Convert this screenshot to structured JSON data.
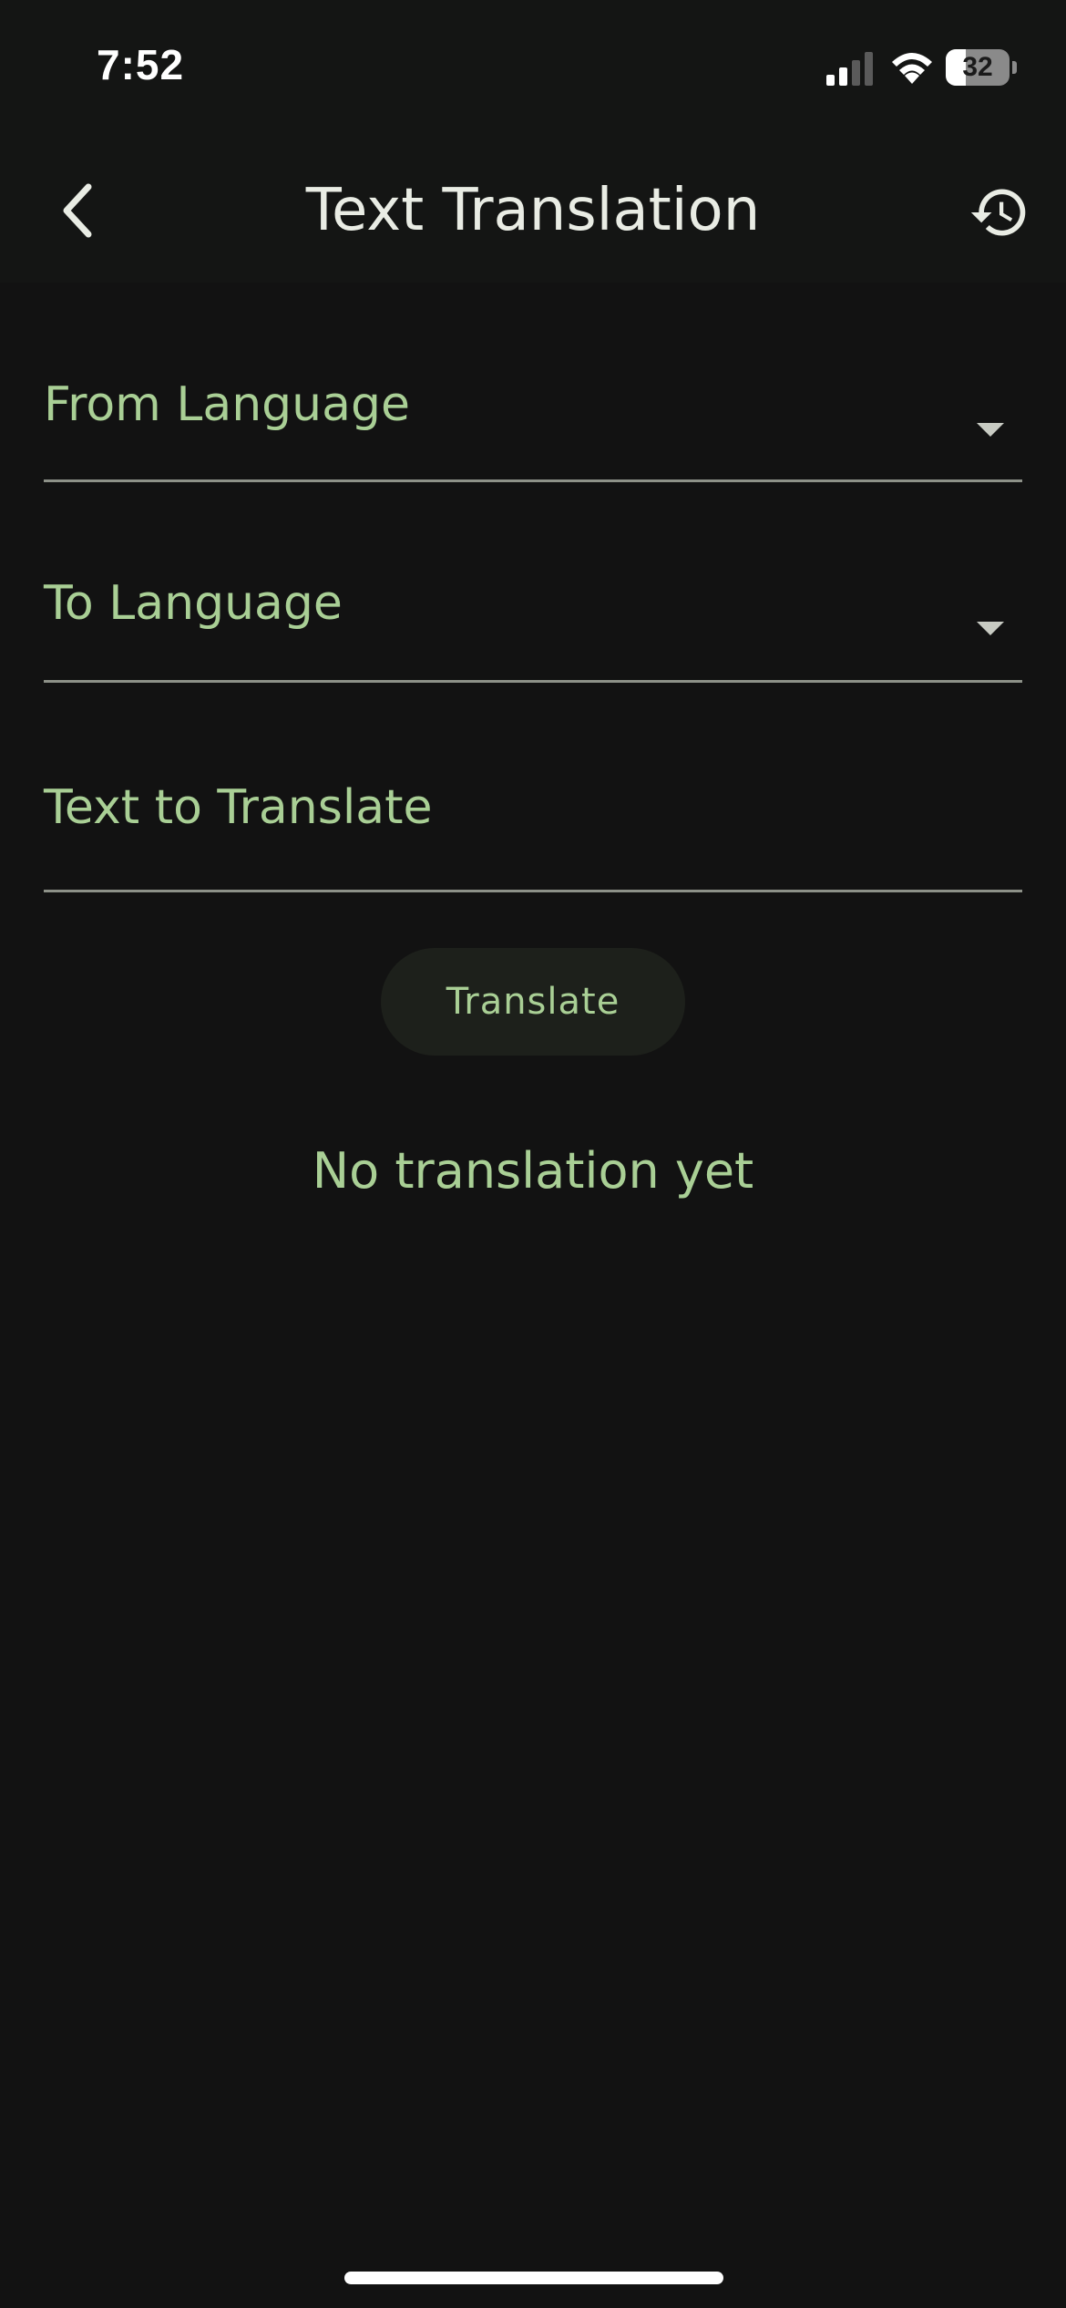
{
  "status_bar": {
    "time": "7:52",
    "battery_level": "32",
    "battery_fraction": 0.32,
    "signal_bars_active": 2,
    "signal_bars_total": 4
  },
  "header": {
    "title": "Text Translation",
    "back_icon": "chevron-left-icon",
    "history_icon": "history-icon"
  },
  "form": {
    "from_language_label": "From Language",
    "to_language_label": "To Language",
    "text_label": "Text to Translate",
    "translate_label": "Translate"
  },
  "result": {
    "empty_text": "No translation yet"
  },
  "colors": {
    "background": "#121212",
    "app_bar": "#141514",
    "accent_label": "#a9cf95",
    "title_text": "#e9ece4",
    "divider": "#8d9188",
    "button_bg": "#1d201b"
  }
}
